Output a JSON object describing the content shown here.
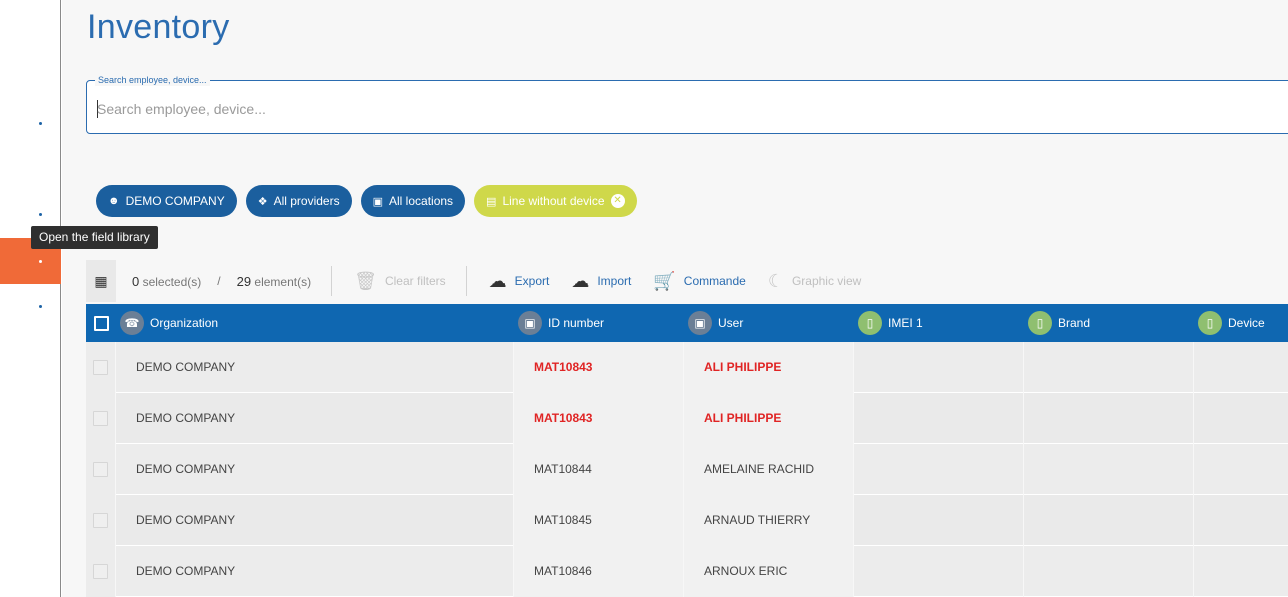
{
  "page": {
    "title": "Inventory"
  },
  "tooltip": "Open the field library",
  "search": {
    "legend": "Search employee, device...",
    "placeholder": "Search employee, device...",
    "value": ""
  },
  "filters": {
    "company": "DEMO COMPANY",
    "providers": "All providers",
    "locations": "All locations",
    "line_without_device": "Line without device"
  },
  "toolbar": {
    "selected_count": "0",
    "selected_label": "selected(s)",
    "separator": "/",
    "element_count": "29",
    "element_label": "element(s)",
    "clear_filters": "Clear filters",
    "export": "Export",
    "import": "Import",
    "commande": "Commande",
    "graphic_view": "Graphic view"
  },
  "columns": [
    "Organization",
    "ID number",
    "User",
    "IMEI 1",
    "Brand",
    "Device"
  ],
  "rows": [
    {
      "organization": "DEMO COMPANY",
      "id": "MAT10843",
      "user": "ALI PHILIPPE",
      "highlight": true
    },
    {
      "organization": "DEMO COMPANY",
      "id": "MAT10843",
      "user": "ALI PHILIPPE",
      "highlight": true
    },
    {
      "organization": "DEMO COMPANY",
      "id": "MAT10844",
      "user": "AMELAINE RACHID",
      "highlight": false
    },
    {
      "organization": "DEMO COMPANY",
      "id": "MAT10845",
      "user": "ARNAUD THIERRY",
      "highlight": false
    },
    {
      "organization": "DEMO COMPANY",
      "id": "MAT10846",
      "user": "ARNOUX ERIC",
      "highlight": false
    }
  ],
  "colors": {
    "primary": "#0f67b1",
    "accent": "#f06a38",
    "highlight_text": "#e02424",
    "filter_yellow": "#cfd84a"
  }
}
